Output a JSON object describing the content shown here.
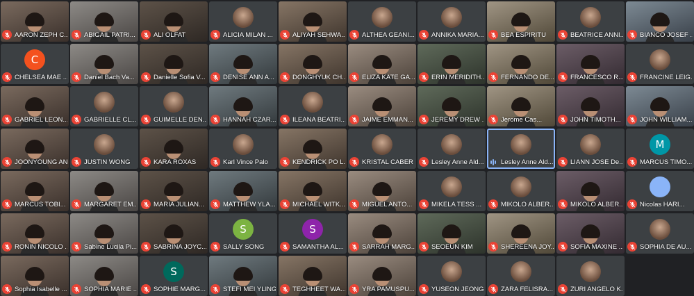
{
  "participants": [
    {
      "name": "AARON ZEPH C...",
      "muted": true,
      "video": true
    },
    {
      "name": "ABIGAIL PATRI...",
      "muted": true,
      "video": true
    },
    {
      "name": "ALI OLFAT",
      "muted": true,
      "video": true
    },
    {
      "name": "ALICIA MILAN ...",
      "muted": true,
      "video": false,
      "avatar_type": "photo"
    },
    {
      "name": "ALIYAH SEHWA...",
      "muted": true,
      "video": true
    },
    {
      "name": "ALTHEA GEANI...",
      "muted": true,
      "video": false,
      "avatar_type": "photo"
    },
    {
      "name": "ANNIKA MARIA...",
      "muted": true,
      "video": false,
      "avatar_type": "photo"
    },
    {
      "name": "BEA ESPIRITU",
      "muted": true,
      "video": true
    },
    {
      "name": "BEATRICE ANNI...",
      "muted": true,
      "video": false,
      "avatar_type": "photo"
    },
    {
      "name": "BIANCO JOSEF ...",
      "muted": true,
      "video": true
    },
    {
      "name": "CHELSEA MAE ...",
      "muted": true,
      "video": false,
      "avatar_letter": "C",
      "avatar_color": "#f4511e"
    },
    {
      "name": "Daniel Bach Va...",
      "muted": true,
      "video": true
    },
    {
      "name": "Danielle Sofia V...",
      "muted": true,
      "video": true
    },
    {
      "name": "DENISE ANN A...",
      "muted": true,
      "video": true
    },
    {
      "name": "DONGHYUK CH...",
      "muted": true,
      "video": true
    },
    {
      "name": "ELIZA KATE GA...",
      "muted": true,
      "video": true
    },
    {
      "name": "ERIN MERIDITH...",
      "muted": true,
      "video": true
    },
    {
      "name": "FERNANDO DE...",
      "muted": true,
      "video": true
    },
    {
      "name": "FRANCESCO R...",
      "muted": true,
      "video": true
    },
    {
      "name": "FRANCINE LEIG...",
      "muted": true,
      "video": false,
      "avatar_type": "photo"
    },
    {
      "name": "GABRIEL LEON...",
      "muted": true,
      "video": true
    },
    {
      "name": "GABRIELLE CL...",
      "muted": true,
      "video": false,
      "avatar_type": "photo"
    },
    {
      "name": "GUIMELLE DEN...",
      "muted": true,
      "video": false,
      "avatar_type": "photo"
    },
    {
      "name": "HANNAH CZAR...",
      "muted": true,
      "video": true
    },
    {
      "name": "ILEANA BEATRI...",
      "muted": true,
      "video": false,
      "avatar_type": "photo"
    },
    {
      "name": "JAIME EMMAN...",
      "muted": true,
      "video": true
    },
    {
      "name": "JEREMY DREW ...",
      "muted": true,
      "video": true
    },
    {
      "name": "Jerome Cas...",
      "muted": true,
      "video": true
    },
    {
      "name": "JOHN TIMOTH...",
      "muted": true,
      "video": true
    },
    {
      "name": "JOHN WILLIAM...",
      "muted": true,
      "video": true
    },
    {
      "name": "JOONYOUNG AN",
      "muted": true,
      "video": true
    },
    {
      "name": "JUSTIN WONG",
      "muted": true,
      "video": false,
      "avatar_type": "photo"
    },
    {
      "name": "KARA ROXAS",
      "muted": true,
      "video": true
    },
    {
      "name": "Karl Vince Palo",
      "muted": true,
      "video": false,
      "avatar_type": "photo"
    },
    {
      "name": "KENDRICK PO L...",
      "muted": true,
      "video": true
    },
    {
      "name": "KRISTAL CABER",
      "muted": true,
      "video": false,
      "avatar_type": "photo"
    },
    {
      "name": "Lesley Anne Ald...",
      "muted": true,
      "video": false,
      "avatar_type": "photo"
    },
    {
      "name": "Lesley Anne Ald...",
      "muted": false,
      "speaking": true,
      "video": false,
      "avatar_type": "photo"
    },
    {
      "name": "LIANN JOSE De...",
      "muted": true,
      "video": false,
      "avatar_type": "photo"
    },
    {
      "name": "MARCUS TIMO...",
      "muted": true,
      "video": false,
      "avatar_letter": "M",
      "avatar_color": "#0097a7"
    },
    {
      "name": "MARCUS TOBI...",
      "muted": true,
      "video": true
    },
    {
      "name": "MARGARET EM...",
      "muted": true,
      "video": true
    },
    {
      "name": "MARIA JULIAN...",
      "muted": true,
      "video": true
    },
    {
      "name": "MATTHEW YLA...",
      "muted": true,
      "video": true
    },
    {
      "name": "MICHAEL WITK...",
      "muted": true,
      "video": true
    },
    {
      "name": "MIGUEL ANTO...",
      "muted": true,
      "video": true
    },
    {
      "name": "MIKELA TESS ...",
      "muted": true,
      "video": false,
      "avatar_type": "photo"
    },
    {
      "name": "MIKOLO ALBER...",
      "muted": true,
      "video": false,
      "avatar_type": "photo"
    },
    {
      "name": "MIKOLO ALBER...",
      "muted": true,
      "video": true
    },
    {
      "name": "Nicolas HARI...",
      "muted": true,
      "video": false,
      "avatar_letter": "",
      "avatar_color": "#8ab4f8"
    },
    {
      "name": "RONIN NICOLO ...",
      "muted": true,
      "video": true
    },
    {
      "name": "Sabine Lucila Pi...",
      "muted": true,
      "video": true
    },
    {
      "name": "SABRINA JOYC...",
      "muted": true,
      "video": true
    },
    {
      "name": "SALLY SONG",
      "muted": true,
      "video": false,
      "avatar_letter": "S",
      "avatar_color": "#7cb342"
    },
    {
      "name": "SAMANTHA AL...",
      "muted": true,
      "video": false,
      "avatar_letter": "S",
      "avatar_color": "#8e24aa"
    },
    {
      "name": "SARRAH MARG...",
      "muted": true,
      "video": true
    },
    {
      "name": "SEOEUN KIM",
      "muted": true,
      "video": true
    },
    {
      "name": "SHEREENA JOY...",
      "muted": true,
      "video": true
    },
    {
      "name": "SOFIA MAXINE ...",
      "muted": true,
      "video": true
    },
    {
      "name": "SOPHIA DE AU...",
      "muted": true,
      "video": false,
      "avatar_type": "photo"
    },
    {
      "name": "Sophia Isabelle ...",
      "muted": true,
      "video": true
    },
    {
      "name": "SOPHIA MARIE ...",
      "muted": true,
      "video": true
    },
    {
      "name": "SOPHIE MARG...",
      "muted": true,
      "video": false,
      "avatar_letter": "S",
      "avatar_color": "#00695c"
    },
    {
      "name": "STEFI MEI YLING",
      "muted": true,
      "video": true
    },
    {
      "name": "TEGHHEET WA...",
      "muted": true,
      "video": true
    },
    {
      "name": "YRA PAMUSPU...",
      "muted": true,
      "video": true
    },
    {
      "name": "YUSEON JEONG",
      "muted": true,
      "video": false,
      "avatar_type": "photo"
    },
    {
      "name": "ZARA FELISRA...",
      "muted": true,
      "video": false,
      "avatar_type": "photo"
    },
    {
      "name": "ZURI ANGELO K...",
      "muted": true,
      "video": false,
      "avatar_type": "photo"
    }
  ],
  "colors": {
    "background": "#202124",
    "tile": "#3c4043",
    "mute_red": "#ea4335",
    "speaking_blue": "#8ab4f8"
  }
}
